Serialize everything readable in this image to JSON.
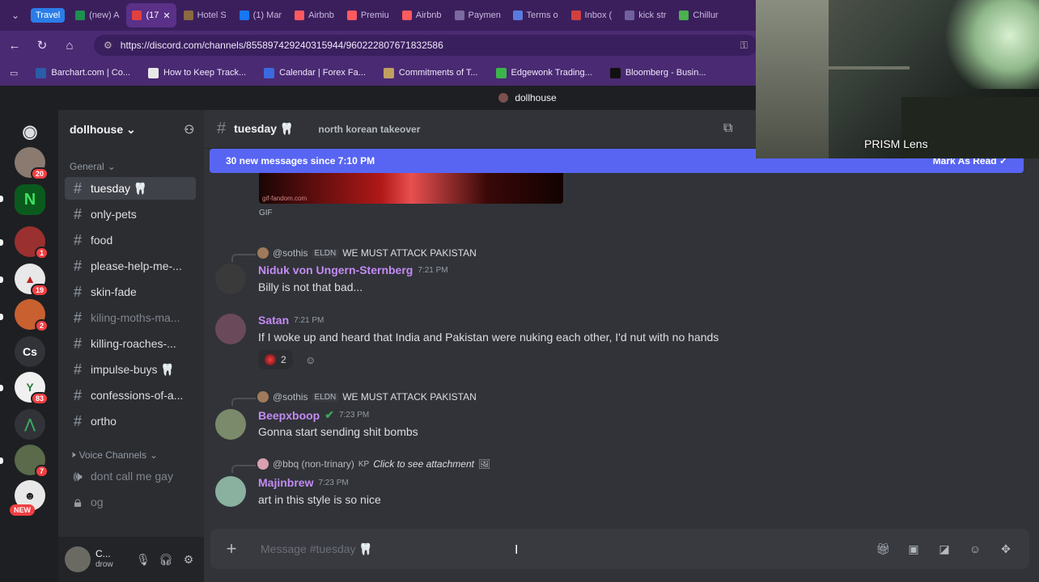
{
  "browser": {
    "tab_group": "Travel",
    "tabs": [
      {
        "label": "(new) A",
        "color": "#1d8f4e"
      },
      {
        "label": "(17",
        "color": "#e04040",
        "active": true
      },
      {
        "label": "Hotel S",
        "color": "#8a6a40"
      },
      {
        "label": "(1) Mar",
        "color": "#1877f2"
      },
      {
        "label": "Airbnb",
        "color": "#ff5a5f"
      },
      {
        "label": "Premiu",
        "color": "#ff5a5f"
      },
      {
        "label": "Airbnb",
        "color": "#ff5a5f"
      },
      {
        "label": "Paymen",
        "color": "#7a6aa0"
      },
      {
        "label": "Terms o",
        "color": "#5a7ae0"
      },
      {
        "label": "Inbox (",
        "color": "#d04040"
      },
      {
        "label": "kick str",
        "color": "#7060a0"
      },
      {
        "label": "Chillur",
        "color": "#4caf50"
      }
    ],
    "url": "https://discord.com/channels/855897429240315944/960222807671832586",
    "bookmarks": [
      {
        "label": "Barchart.com | Co...",
        "color": "#2a5ca8"
      },
      {
        "label": "How to Keep Track...",
        "color": "#e8e8e8"
      },
      {
        "label": "Calendar | Forex Fa...",
        "color": "#3a6ae0"
      },
      {
        "label": "Commitments of T...",
        "color": "#c0a060"
      },
      {
        "label": "Edgewonk Trading...",
        "color": "#3bb54a"
      },
      {
        "label": "Bloomberg - Busin...",
        "color": "#111111"
      }
    ]
  },
  "app": {
    "server_title": "dollhouse"
  },
  "server": {
    "name": "dollhouse",
    "category_general": "General",
    "category_voice": "Voice Channels",
    "channels": [
      {
        "name": "tuesday 🦷",
        "selected": true,
        "unread": false,
        "muted": false
      },
      {
        "name": "only-pets",
        "unread": true
      },
      {
        "name": "food",
        "unread": true
      },
      {
        "name": "please-help-me-...",
        "unread": true
      },
      {
        "name": "skin-fade",
        "unread": true
      },
      {
        "name": "kiling-moths-ma...",
        "muted": true
      },
      {
        "name": "killing-roaches-...",
        "unread": true
      },
      {
        "name": "impulse-buys 🦷",
        "unread": true
      },
      {
        "name": "confessions-of-a...",
        "unread": true
      },
      {
        "name": "ortho",
        "unread": true
      }
    ],
    "voice_channels": [
      {
        "name": "dont call me gay"
      },
      {
        "name": "og"
      }
    ]
  },
  "guilds": {
    "badges": [
      "20",
      "1",
      "19",
      "2",
      "83",
      "7"
    ],
    "cs_label": "Cs",
    "new_label": "NEW"
  },
  "user": {
    "name": "C...",
    "status": "drow"
  },
  "channel": {
    "name": "tuesday 🦷",
    "topic": "north korean takeover"
  },
  "new_messages": {
    "text": "30 new messages since 7:10 PM",
    "mark_read": "Mark As Read"
  },
  "gif": {
    "label": "GIF",
    "watermark": "gif-fandom.com"
  },
  "messages": [
    {
      "reply_user": "@sothis",
      "reply_tag": "ELDN",
      "reply_text": "WE MUST ATTACK PAKISTAN",
      "author": "Niduk von Ungern-Sternberg",
      "author_color": "#c38bf5",
      "time": "7:21 PM",
      "text": "Billy is not that bad..."
    },
    {
      "author": "Satan",
      "author_color": "#c38bf5",
      "time": "7:21 PM",
      "text": "If I woke up and heard that India and Pakistan were nuking each other, I'd nut with no hands",
      "reaction_count": "2"
    },
    {
      "reply_user": "@sothis",
      "reply_tag": "ELDN",
      "reply_text": "WE MUST ATTACK PAKISTAN",
      "author": "Beepxboop",
      "author_color": "#c38bf5",
      "time": "7:23 PM",
      "text": "Gonna start sending shit bombs"
    },
    {
      "reply_user": "@bbq (non-trinary)",
      "reply_tag": "KP",
      "reply_text": "Click to see attachment",
      "author": "Majinbrew",
      "author_color": "#c38bf5",
      "time": "7:23 PM",
      "text": "art in this style is so nice"
    }
  ],
  "composer": {
    "placeholder": "Message #tuesday 🦷"
  },
  "webcam": {
    "label": "PRISM Lens"
  }
}
